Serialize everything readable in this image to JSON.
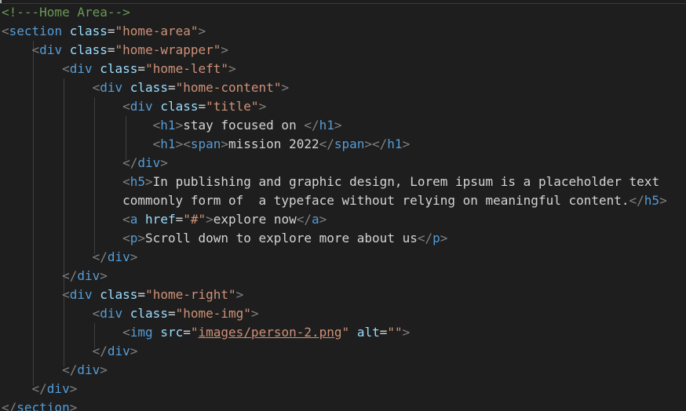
{
  "editor": {
    "comment": "<!---Home Area-->",
    "section_tag": "section",
    "div_tag": "div",
    "h1_tag": "h1",
    "span_tag": "span",
    "h5_tag": "h5",
    "a_tag": "a",
    "p_tag": "p",
    "img_tag": "img",
    "class_attr": "class",
    "href_attr": "href",
    "src_attr": "src",
    "alt_attr": "alt",
    "home_area": "\"home-area\"",
    "home_wrapper": "\"home-wrapper\"",
    "home_left": "\"home-left\"",
    "home_content": "\"home-content\"",
    "title_class": "\"title\"",
    "home_right": "\"home-right\"",
    "home_img": "\"home-img\"",
    "href_value": "\"#\"",
    "q": "\"",
    "img_src": "images/person-2.png",
    "alt_value": "\"\"",
    "h1_line1": "stay focused on ",
    "h1_line2": "mission 2022",
    "h5_text_1": "In publishing and graphic design, Lorem ipsum is a placeholder text",
    "h5_text_2": "commonly form of  a typeface without relying on meaningful content.",
    "a_text": "explore now",
    "p_text": "Scroll down to explore more about us"
  }
}
